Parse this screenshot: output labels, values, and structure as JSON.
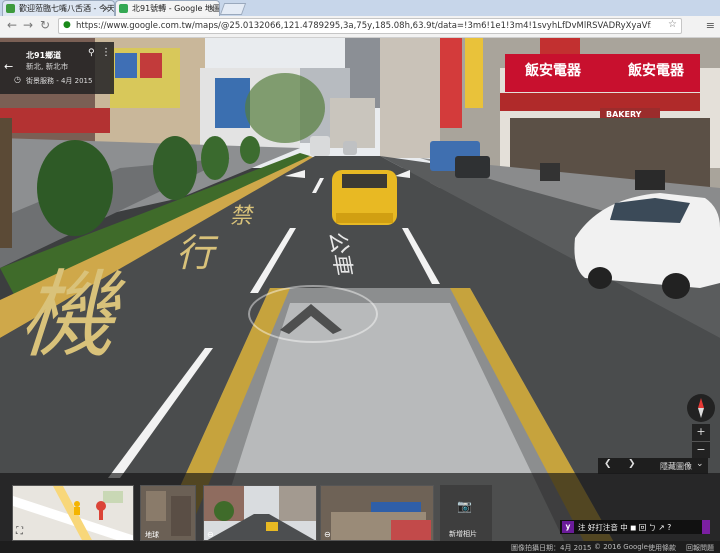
{
  "browser": {
    "tabs": [
      {
        "title": "歡迎蒞臨七嘴八舌酒 - 今天",
        "active": false,
        "favicon_color": "#3d9a3d"
      },
      {
        "title": "北91號轉 - Google 地圖",
        "active": true,
        "favicon_color": "#34a853"
      }
    ],
    "close_glyph": "×",
    "url": "https://www.google.com.tw/maps/@25.0132066,121.4789295,3a,75y,185.08h,63.9t/data=!3m6!1e1!3m4!1svyhLfDvMlRSVADRyXyaVfA!2e0!7i13312!8i6656!6m1!1",
    "nav_back": "←",
    "nav_forward": "→",
    "nav_reload": "↻"
  },
  "place_card": {
    "title": "北91鄉道",
    "subtitle": "新北, 新北市",
    "date_prefix": "街景服務 - 4月 2015",
    "back_icon": "arrow-left-icon",
    "pin_icon": "map-pin-icon",
    "more_icon": "more-vert-icon"
  },
  "road_markings": {
    "chars": [
      "禁",
      "行",
      "機"
    ],
    "bus_lane_text": "公車"
  },
  "shop_signs": [
    {
      "text": "飯安電器",
      "color": "#c8102e"
    },
    {
      "text": "飯安電器",
      "color": "#c8102e"
    },
    {
      "text": "BAKERY",
      "color": "#9b2c2c"
    }
  ],
  "timeline": {
    "prev": "❮",
    "next": "❯",
    "label": "隱藏圖像",
    "collapse": "⌄"
  },
  "thumbnails": [
    {
      "kind": "map",
      "label": ""
    },
    {
      "kind": "photo",
      "label": "地球"
    },
    {
      "kind": "street",
      "label": ""
    },
    {
      "kind": "shop",
      "label": ""
    }
  ],
  "add_photo": {
    "label": "新增相片",
    "icon": "camera-plus-icon"
  },
  "zoom": {
    "plus": "+",
    "minus": "−"
  },
  "ime_bar": {
    "text": "注 好打注音 中 ◼ 回 ㄅ ↗ ?"
  },
  "footer": {
    "capture": "圖像拍攝日期：4月 2015",
    "copyright": "© 2016 Google",
    "terms": "使用條款",
    "feedback": "回報問題"
  },
  "colors": {
    "road": "#4a4c4d",
    "lane_yellow": "#d4b44a",
    "sign_red": "#c8102e",
    "taxi": "#e8b923"
  }
}
